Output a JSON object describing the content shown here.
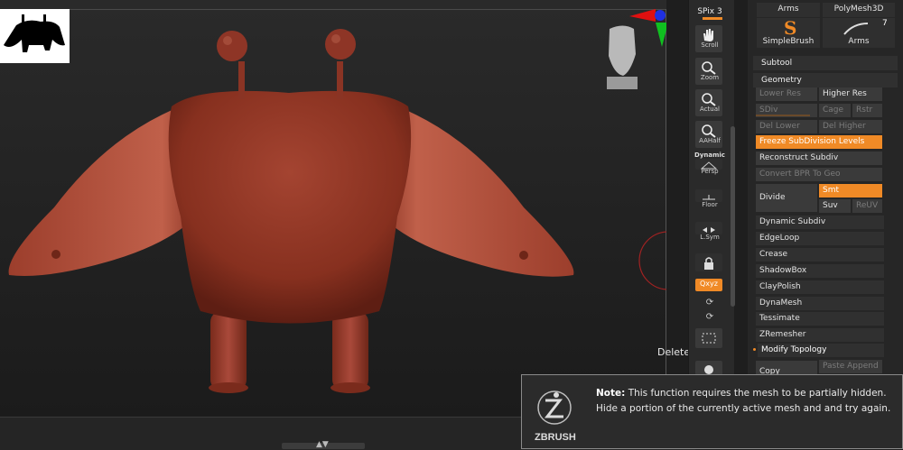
{
  "app": {
    "brand": "ZBRUSH"
  },
  "shelf": [
    {
      "name": "spix",
      "label": "SPix 3"
    },
    {
      "name": "scroll",
      "label": "Scroll"
    },
    {
      "name": "zoom",
      "label": "Zoom"
    },
    {
      "name": "actual",
      "label": "Actual"
    },
    {
      "name": "aahalf",
      "label": "AAHalf"
    },
    {
      "name": "persp",
      "label": "Persp",
      "top": "Dynamic"
    },
    {
      "name": "floor",
      "label": "Floor"
    },
    {
      "name": "lsym",
      "label": "L.Sym"
    },
    {
      "name": "xyz",
      "label": "Qxyz"
    }
  ],
  "palette": {
    "top_items": [
      "Arms",
      "PolyMesh3D",
      "SimpleBrush",
      "Arms"
    ],
    "top_count": "7",
    "subtool": "Subtool",
    "geometry": "Geometry",
    "buttons": {
      "lower_res": "Lower Res",
      "higher_res": "Higher Res",
      "sdiv": "SDiv",
      "cage": "Cage",
      "rstr": "Rstr",
      "del_lower": "Del Lower",
      "del_higher": "Del Higher",
      "freeze": "Freeze SubDivision Levels",
      "reconstruct": "Reconstruct Subdiv",
      "convert_bpr": "Convert BPR To Geo",
      "divide": "Divide",
      "smt": "Smt",
      "suv": "Suv",
      "reuv": "ReUV",
      "dynamic_subdiv": "Dynamic Subdiv",
      "edgeloop": "EdgeLoop",
      "crease": "Crease",
      "shadowbox": "ShadowBox",
      "claypolish": "ClayPolish",
      "dynamesh": "DynaMesh",
      "tessimate": "Tessimate",
      "zremesher": "ZRemesher",
      "modify_topology": "Modify Topology",
      "copy": "Copy",
      "paste_append": "Paste Append"
    }
  },
  "tooltip": "Delete Hidden",
  "note": {
    "heading": "Note:",
    "line1": "This function requires the mesh to be partially hidden.",
    "line2": "Hide a portion of the currently active mesh and and try again."
  },
  "colors": {
    "accent": "#f08a26",
    "model": "#9a3b2c"
  }
}
